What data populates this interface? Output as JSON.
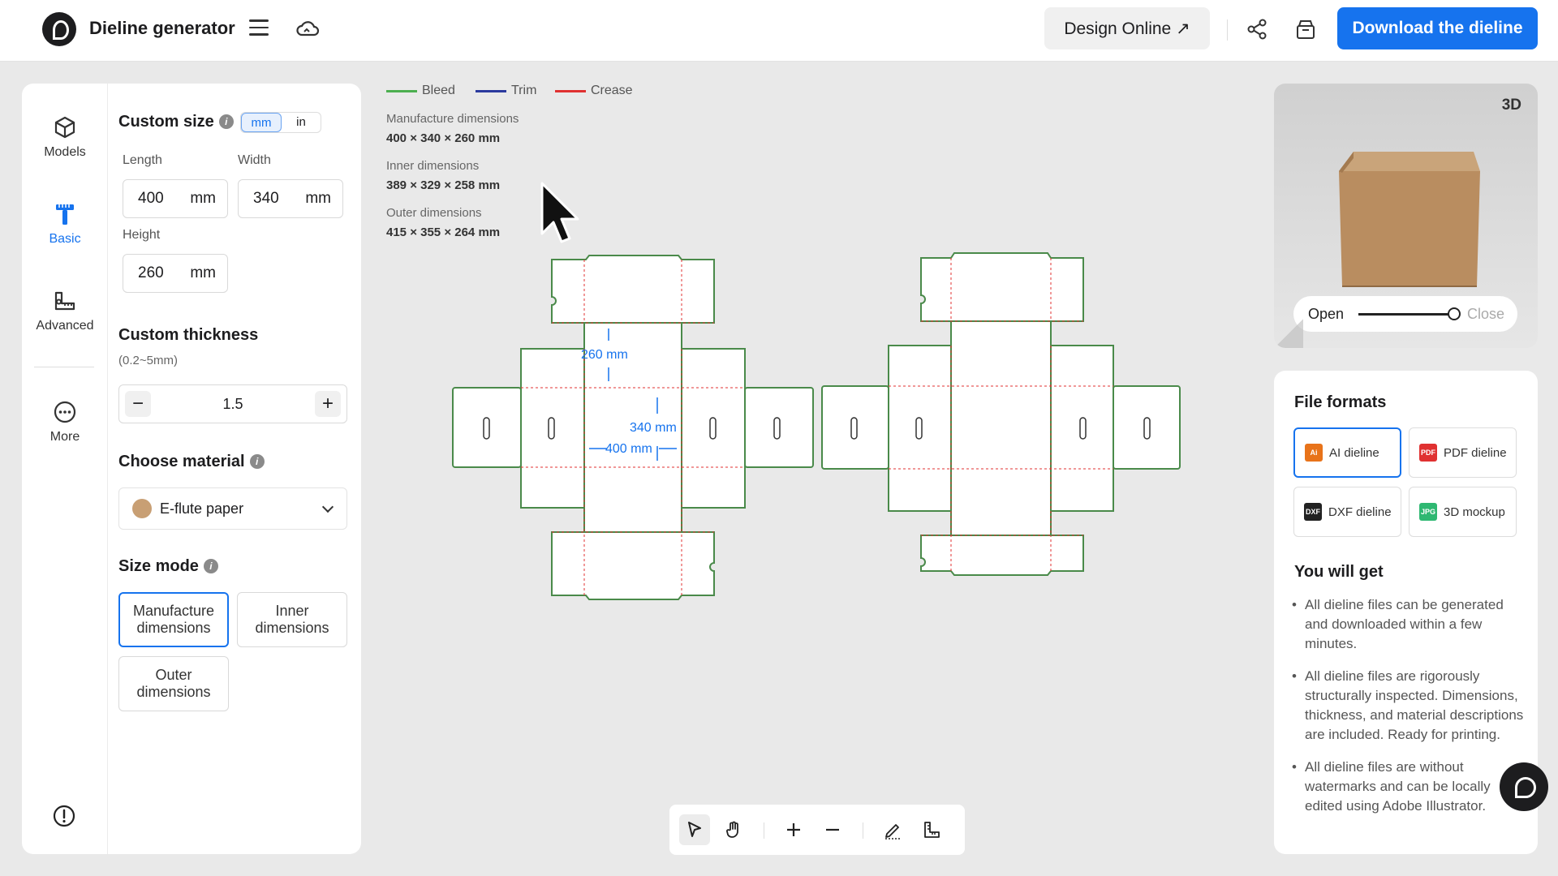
{
  "header": {
    "app_title": "Dieline generator",
    "design_online": "Design Online ↗",
    "download": "Download the dieline"
  },
  "rail": {
    "items": [
      {
        "label": "Models",
        "icon": "cube-icon"
      },
      {
        "label": "Basic",
        "icon": "ruler-icon"
      },
      {
        "label": "Advanced",
        "icon": "advanced-ruler-icon"
      },
      {
        "label": "More",
        "icon": "more-icon"
      }
    ],
    "active": "Basic"
  },
  "custom_size": {
    "title": "Custom size",
    "unit_mm": "mm",
    "unit_in": "in",
    "length_label": "Length",
    "length_value": "400",
    "width_label": "Width",
    "width_value": "340",
    "height_label": "Height",
    "height_value": "260",
    "unit": "mm"
  },
  "thickness": {
    "title": "Custom thickness",
    "range": "(0.2~5mm)",
    "value": "1.5",
    "minus": "−",
    "plus": "+"
  },
  "material": {
    "title": "Choose material",
    "selected": "E-flute paper",
    "swatch_color": "#c89f74"
  },
  "size_mode": {
    "title": "Size mode",
    "options": [
      "Manufacture dimensions",
      "Inner dimensions",
      "Outer dimensions"
    ],
    "selected": "Manufacture dimensions"
  },
  "legend": [
    {
      "label": "Bleed",
      "color": "#4caf50"
    },
    {
      "label": "Trim",
      "color": "#2b3a9e"
    },
    {
      "label": "Crease",
      "color": "#e03131"
    }
  ],
  "dimensions": {
    "manufacture_label": "Manufacture dimensions",
    "manufacture_value": "400 × 340 × 260 mm",
    "inner_label": "Inner dimensions",
    "inner_value": "389 × 329 × 258 mm",
    "outer_label": "Outer dimensions",
    "outer_value": "415 × 355 × 264 mm"
  },
  "dieline_labels": {
    "height": "260 mm",
    "width": "340 mm",
    "length": "400 mm"
  },
  "preview": {
    "badge": "3D",
    "open": "Open",
    "close": "Close",
    "open_level": 0.9
  },
  "file_formats": {
    "title": "File formats",
    "items": [
      {
        "label": "AI dieline",
        "icon_text": "Ai",
        "color": "#e8731a"
      },
      {
        "label": "PDF dieline",
        "icon_text": "PDF",
        "color": "#e03131"
      },
      {
        "label": "DXF dieline",
        "icon_text": "DXF",
        "color": "#222222"
      },
      {
        "label": "3D mockup",
        "icon_text": "JPG",
        "color": "#2fb872"
      }
    ],
    "selected": "AI dieline"
  },
  "you_will_get": {
    "title": "You will get",
    "items": [
      "All dieline files can be generated and downloaded within a few minutes.",
      "All dieline files are rigorously structurally inspected. Dimensions, thickness, and material descriptions are included. Ready for printing.",
      "All dieline files are without watermarks and can be locally edited using Adobe Illustrator."
    ]
  },
  "colors": {
    "accent": "#1673ee"
  }
}
